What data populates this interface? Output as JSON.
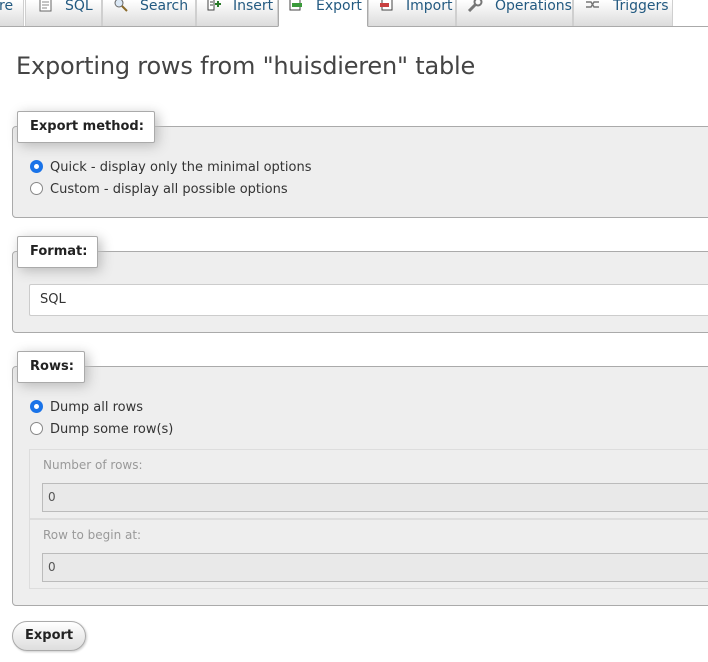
{
  "tabs": [
    {
      "label": "re",
      "icon": "structure-icon"
    },
    {
      "label": "SQL",
      "icon": "sql-icon"
    },
    {
      "label": "Search",
      "icon": "search-icon"
    },
    {
      "label": "Insert",
      "icon": "insert-icon"
    },
    {
      "label": "Export",
      "icon": "export-icon",
      "active": true
    },
    {
      "label": "Import",
      "icon": "import-icon"
    },
    {
      "label": "Operations",
      "icon": "operations-icon"
    },
    {
      "label": "Triggers",
      "icon": "triggers-icon"
    }
  ],
  "page": {
    "title": "Exporting rows from \"huisdieren\" table"
  },
  "export_method": {
    "legend": "Export method:",
    "options": [
      {
        "label": "Quick - display only the minimal options",
        "selected": true
      },
      {
        "label": "Custom - display all possible options",
        "selected": false
      }
    ]
  },
  "format": {
    "legend": "Format:",
    "selected": "SQL"
  },
  "rows": {
    "legend": "Rows:",
    "options": [
      {
        "label": "Dump all rows",
        "selected": true
      },
      {
        "label": "Dump some row(s)",
        "selected": false
      }
    ],
    "number_of_rows": {
      "label": "Number of rows:",
      "value": "0"
    },
    "row_to_begin_at": {
      "label": "Row to begin at:",
      "value": "0"
    }
  },
  "actions": {
    "export_label": "Export"
  },
  "colors": {
    "link": "#235a81",
    "accent": "#1a73e8",
    "panel": "#eeeeee"
  }
}
